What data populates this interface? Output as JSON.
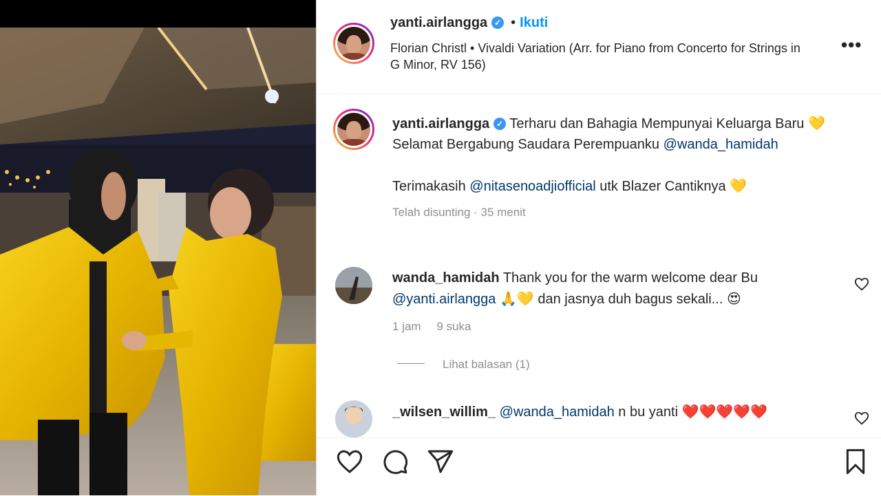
{
  "post": {
    "username": "yanti.airlangga",
    "follow_label": "Ikuti",
    "dot": "•",
    "song": "Florian Christl • Vivaldi Variation (Arr. for Piano from Concerto for Strings in G Minor, RV 156)",
    "more_label": "•••"
  },
  "caption": {
    "username": "yanti.airlangga",
    "line1": "Terharu dan Bahagia Mempunyai Keluarga Baru",
    "emoji1": "💛",
    "line2_text": "Selamat Bergabung Saudara Perempuanku",
    "line2_mention": "@wanda_hamidah",
    "line3_pre": "Terimakasih",
    "line3_mention": "@nitasenoadjiofficial",
    "line3_post": "utk Blazer Cantiknya",
    "emoji2": "💛",
    "meta": "Telah disunting · 35 menit"
  },
  "comments": [
    {
      "username": "wanda_hamidah",
      "text_pre": "Thank you for the warm welcome dear Bu",
      "mention": "@yanti.airlangga",
      "emojis": "🙏💛",
      "text_post": "dan jasnya duh bagus sekali...",
      "emoji_end": "😍",
      "time": "1 jam",
      "likes": "9 suka",
      "replies": "Lihat balasan (1)"
    },
    {
      "username": "_wilsen_willim_",
      "mention": "@wanda_hamidah",
      "text": "n bu yanti",
      "emojis": "❤️❤️❤️❤️❤️"
    }
  ],
  "colors": {
    "link": "#0095f6",
    "mention": "#00376b",
    "muted": "#8e8e8e",
    "blazer": "#e8b400"
  }
}
